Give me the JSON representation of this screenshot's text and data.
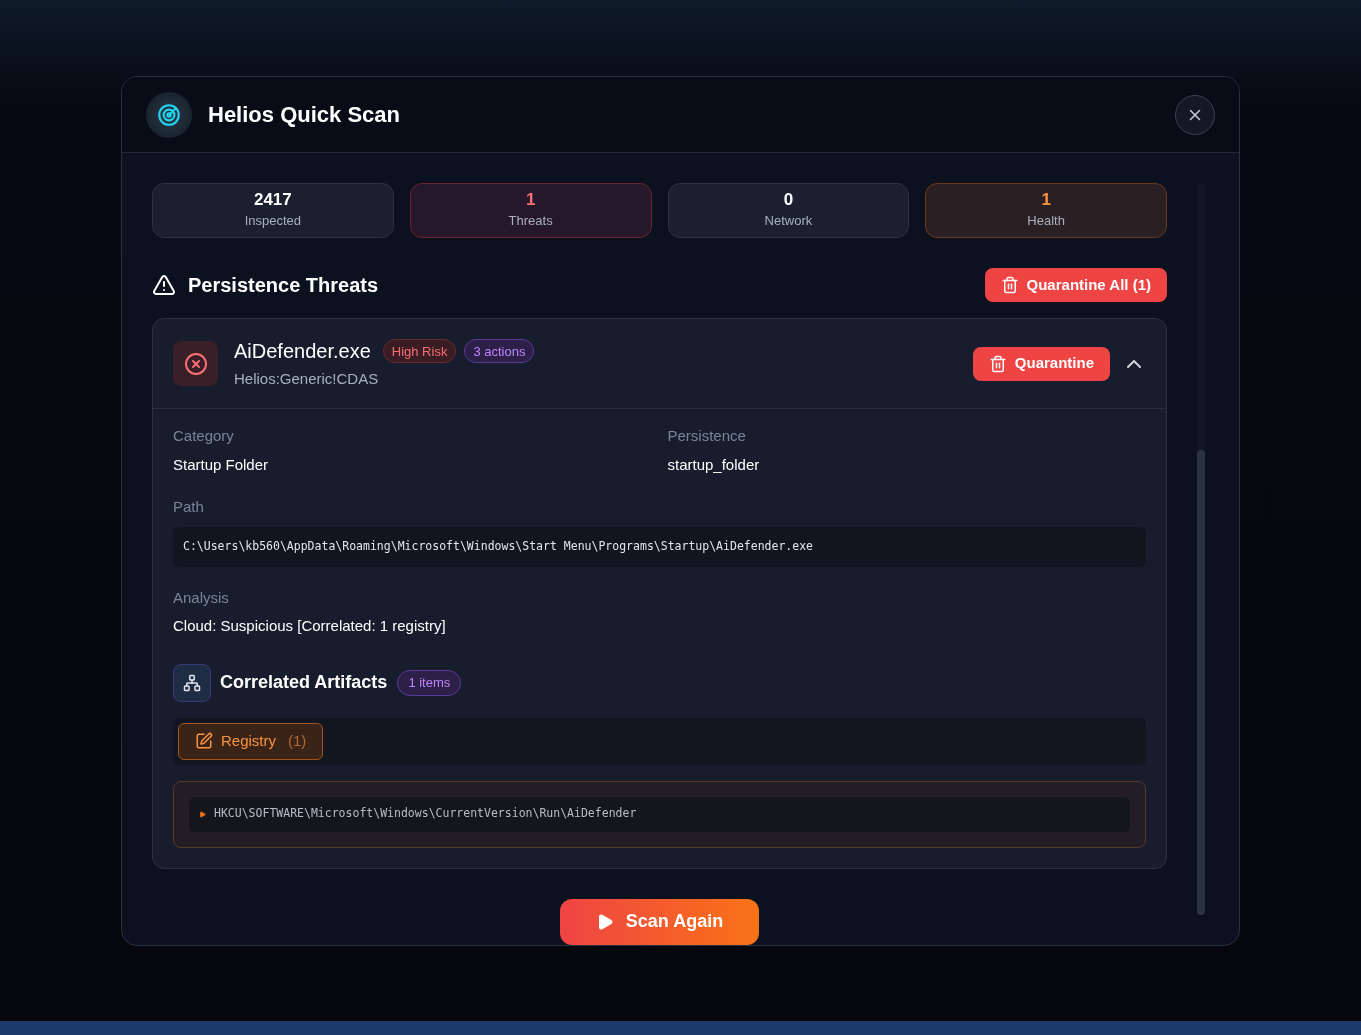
{
  "window": {
    "title": "Helios Quick Scan"
  },
  "stats": [
    {
      "value": "2417",
      "label": "Inspected",
      "kind": "neutral"
    },
    {
      "value": "1",
      "label": "Threats",
      "kind": "danger"
    },
    {
      "value": "0",
      "label": "Network",
      "kind": "neutral"
    },
    {
      "value": "1",
      "label": "Health",
      "kind": "warning"
    }
  ],
  "section": {
    "title": "Persistence Threats",
    "action": "Quarantine All (1)"
  },
  "threats": [
    {
      "name": "AiDefender.exe",
      "risk": "High Risk",
      "actions": "3 actions",
      "signature": "Helios:Generic!CDAS",
      "button": "Quarantine",
      "expanded": true,
      "details": [
        {
          "label": "Category",
          "value": "Startup Folder"
        },
        {
          "label": "Persistence",
          "value": "startup_folder"
        }
      ],
      "path_label": "Path",
      "path": "C:\\Users\\kb560\\AppData\\Roaming\\Microsoft\\Windows\\Start Menu\\Programs\\Startup\\AiDefender.exe",
      "analysis_label": "Analysis",
      "analysis": "Cloud: Suspicious [Correlated: 1 registry]",
      "artifacts": {
        "title": "Correlated Artifacts",
        "count": "1 items",
        "tabs": [
          {
            "label": "Registry",
            "count": "(1)",
            "selected": true
          }
        ],
        "entries": [
          "HKCU\\SOFTWARE\\Microsoft\\Windows\\CurrentVersion\\Run\\AiDefender"
        ]
      }
    }
  ],
  "footer": {
    "button": "Scan Again"
  }
}
